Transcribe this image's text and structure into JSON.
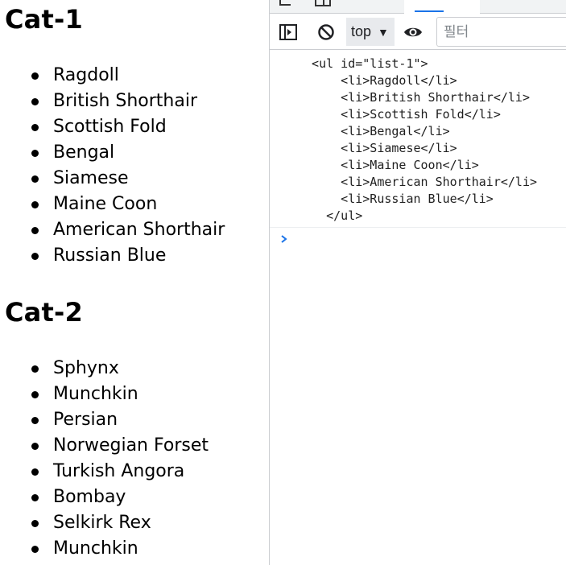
{
  "page": {
    "cat1": {
      "heading": "Cat-1",
      "items": [
        "Ragdoll",
        "British Shorthair",
        "Scottish Fold",
        "Bengal",
        "Siamese",
        "Maine Coon",
        "American Shorthair",
        "Russian Blue"
      ]
    },
    "cat2": {
      "heading": "Cat-2",
      "items": [
        "Sphynx",
        "Munchkin",
        "Persian",
        "Norwegian Forset",
        "Turkish Angora",
        "Bombay",
        "Selkirk Rex",
        "Munchkin"
      ]
    }
  },
  "devtools": {
    "toolbar": {
      "sidebar_icon": "console-sidebar-icon",
      "clear_icon": "clear-console-icon",
      "context_label": "top",
      "eye_icon": "live-expression-eye-icon",
      "filter_placeholder": "필터"
    },
    "console": {
      "output_lines": [
        "  <ul id=\"list-1\">",
        "      <li>Ragdoll</li>",
        "      <li>British Shorthair</li>",
        "      <li>Scottish Fold</li>",
        "      <li>Bengal</li>",
        "      <li>Siamese</li>",
        "      <li>Maine Coon</li>",
        "      <li>American Shorthair</li>",
        "      <li>Russian Blue</li>",
        "    </ul>"
      ],
      "prompt_icon": "chevron-right-prompt-icon"
    },
    "accent_color": "#1a73e8"
  }
}
